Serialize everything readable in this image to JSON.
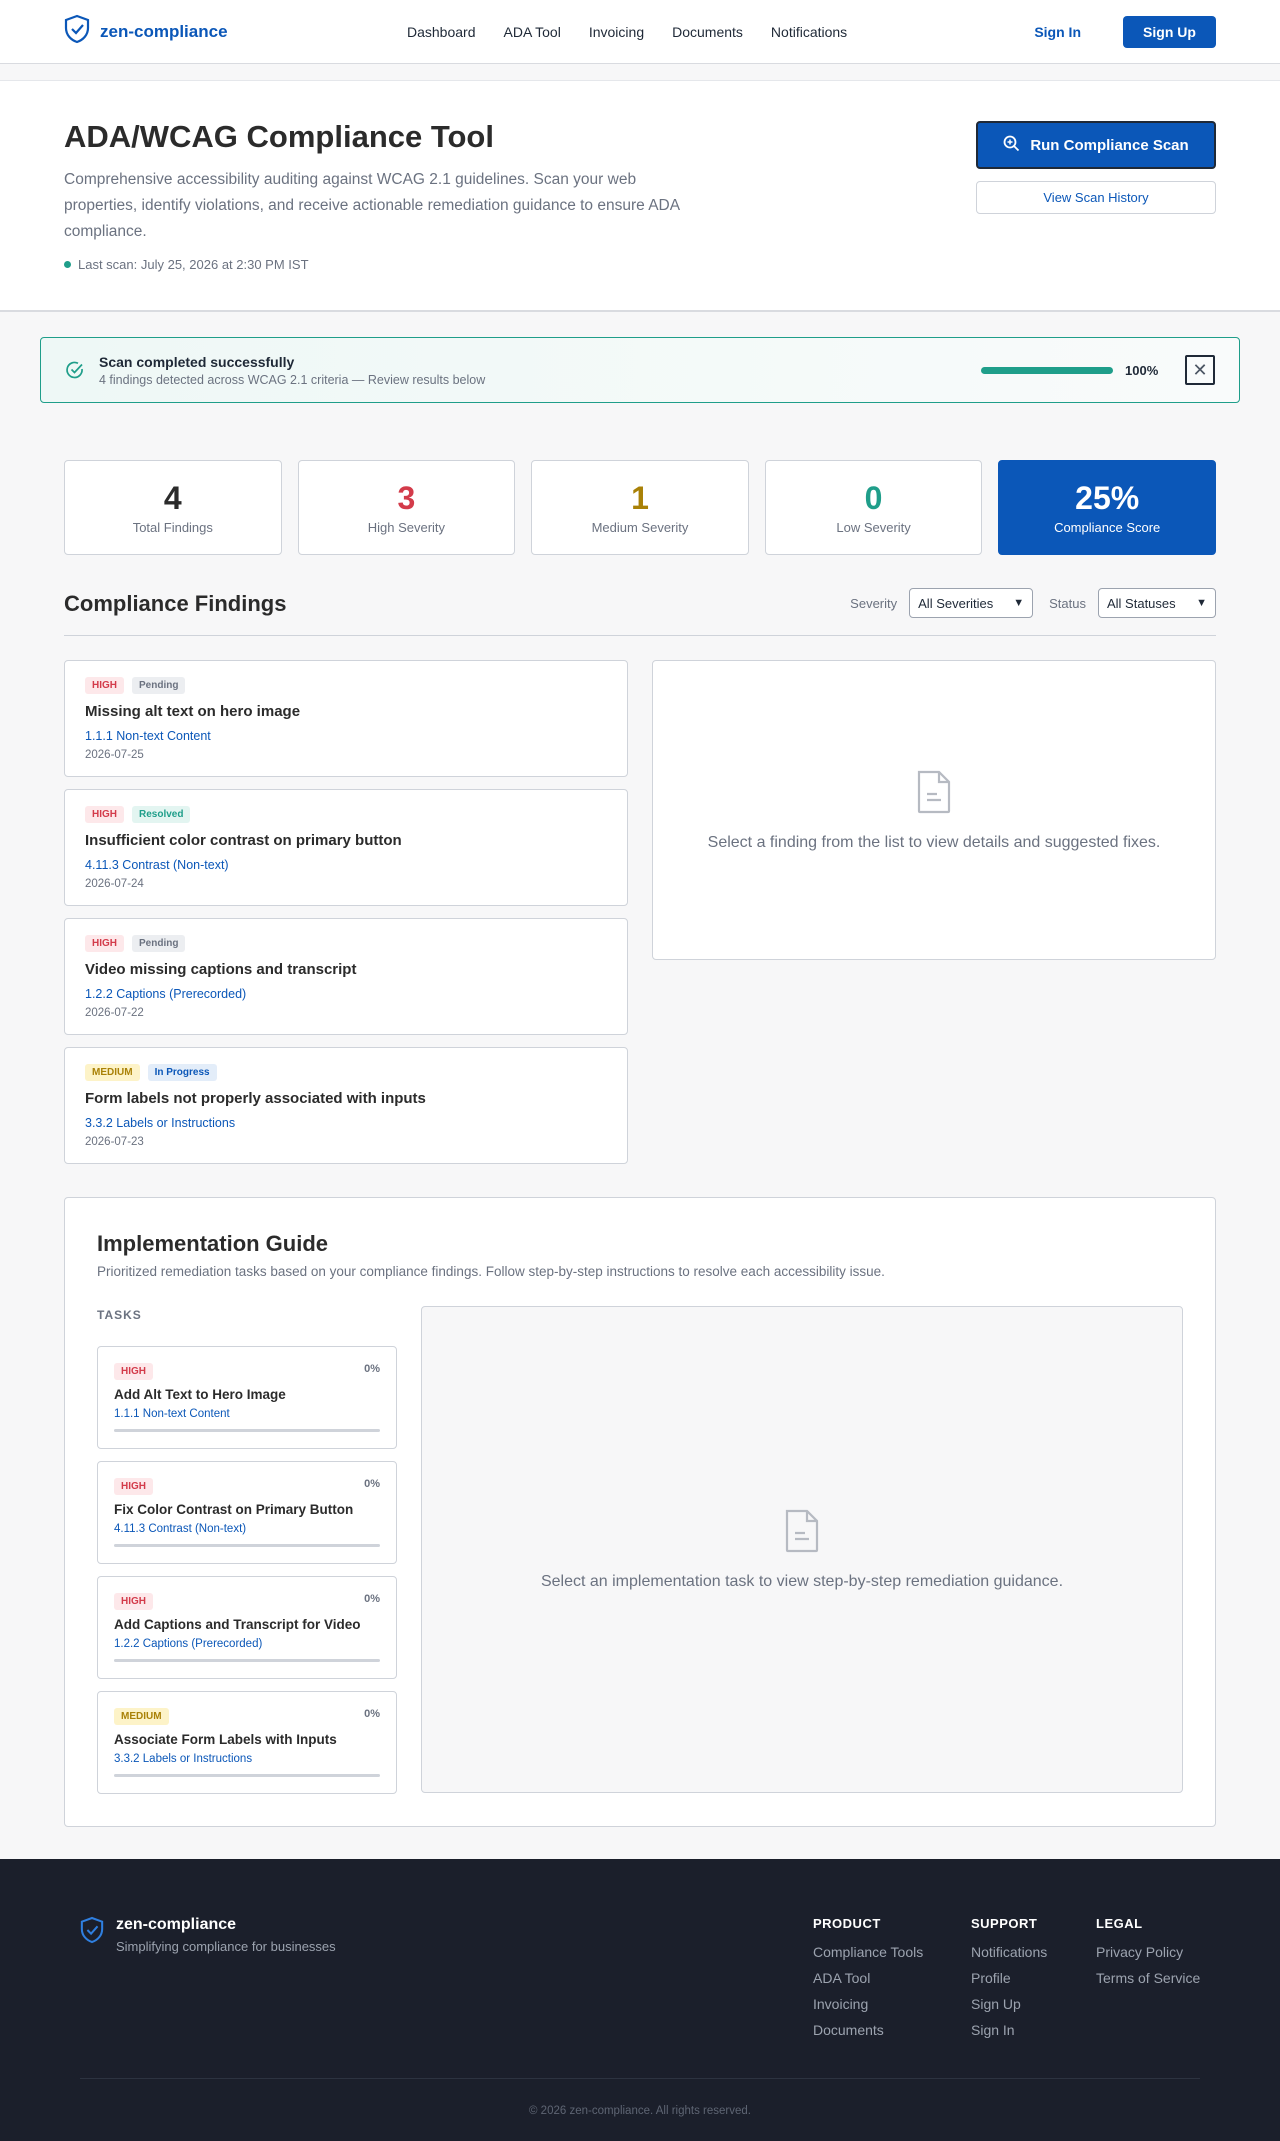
{
  "brand": {
    "name": "zen-compliance",
    "tagline": "Simplifying compliance for businesses"
  },
  "nav": {
    "items": [
      "Dashboard",
      "ADA Tool",
      "Invoicing",
      "Documents",
      "Notifications"
    ],
    "sign_in": "Sign In",
    "sign_up": "Sign Up"
  },
  "hero": {
    "title": "ADA/WCAG Compliance Tool",
    "description": "Comprehensive accessibility auditing against WCAG 2.1 guidelines. Scan your web properties, identify violations, and receive actionable remediation guidance to ensure ADA compliance.",
    "last_scan": "Last scan: July 25, 2026 at 2:30 PM IST",
    "run_button": "Run Compliance Scan",
    "history_button": "View Scan History"
  },
  "banner": {
    "title": "Scan completed successfully",
    "subtitle": "4 findings detected across WCAG 2.1 criteria — Review results below",
    "progress_percent": 100,
    "progress_label": "100%"
  },
  "stats": [
    {
      "value": "4",
      "label": "Total Findings"
    },
    {
      "value": "3",
      "label": "High Severity"
    },
    {
      "value": "1",
      "label": "Medium Severity"
    },
    {
      "value": "0",
      "label": "Low Severity"
    },
    {
      "value": "25%",
      "label": "Compliance Score"
    }
  ],
  "findings": {
    "title": "Compliance Findings",
    "severity_label": "Severity",
    "severity_value": "All Severities",
    "status_label": "Status",
    "status_value": "All Statuses",
    "items": [
      {
        "severity": "HIGH",
        "status": "Pending",
        "title": "Missing alt text on hero image",
        "ref": "1.1.1 Non-text Content",
        "date": "2026-07-25"
      },
      {
        "severity": "HIGH",
        "status": "Resolved",
        "title": "Insufficient color contrast on primary button",
        "ref": "4.11.3 Contrast (Non-text)",
        "date": "2026-07-24"
      },
      {
        "severity": "HIGH",
        "status": "Pending",
        "title": "Video missing captions and transcript",
        "ref": "1.2.2 Captions (Prerecorded)",
        "date": "2026-07-22"
      },
      {
        "severity": "MEDIUM",
        "status": "In Progress",
        "title": "Form labels not properly associated with inputs",
        "ref": "3.3.2 Labels or Instructions",
        "date": "2026-07-23"
      }
    ],
    "empty_message": "Select a finding from the list to view details and suggested fixes."
  },
  "guide": {
    "title": "Implementation Guide",
    "description": "Prioritized remediation tasks based on your compliance findings. Follow step-by-step instructions to resolve each accessibility issue.",
    "tasks_label": "TASKS",
    "tasks": [
      {
        "severity": "HIGH",
        "progress": "0%",
        "title": "Add Alt Text to Hero Image",
        "ref": "1.1.1 Non-text Content"
      },
      {
        "severity": "HIGH",
        "progress": "0%",
        "title": "Fix Color Contrast on Primary Button",
        "ref": "4.11.3 Contrast (Non-text)"
      },
      {
        "severity": "HIGH",
        "progress": "0%",
        "title": "Add Captions and Transcript for Video",
        "ref": "1.2.2 Captions (Prerecorded)"
      },
      {
        "severity": "MEDIUM",
        "progress": "0%",
        "title": "Associate Form Labels with Inputs",
        "ref": "3.3.2 Labels or Instructions"
      }
    ],
    "empty_message": "Select an implementation task to view step-by-step remediation guidance."
  },
  "footer": {
    "columns": [
      {
        "heading": "PRODUCT",
        "links": [
          "Compliance Tools",
          "ADA Tool",
          "Invoicing",
          "Documents"
        ]
      },
      {
        "heading": "SUPPORT",
        "links": [
          "Notifications",
          "Profile",
          "Sign Up",
          "Sign In"
        ]
      },
      {
        "heading": "LEGAL",
        "links": [
          "Privacy Policy",
          "Terms of Service"
        ]
      }
    ],
    "copyright": "© 2026 zen-compliance. All rights reserved."
  },
  "colors": {
    "brand": "#0b57b8",
    "high": "#d33b4a",
    "medium": "#a98107",
    "low": "#1f9e8a",
    "footer_bg": "#1b1f2b"
  }
}
